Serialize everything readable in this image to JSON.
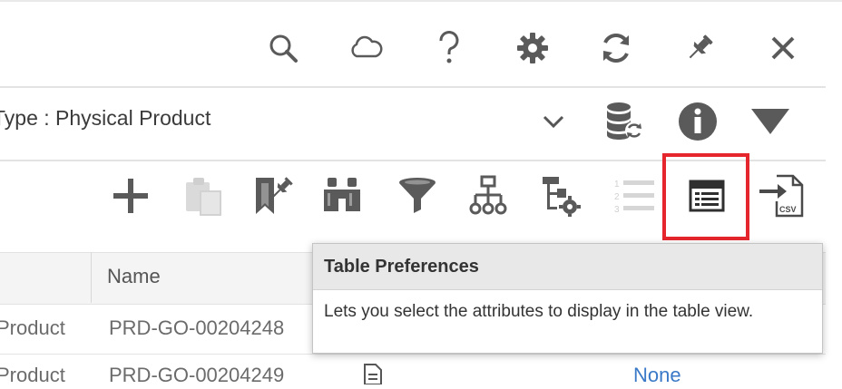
{
  "header": {
    "icons": [
      "search-icon",
      "cloud-icon",
      "help-icon",
      "settings-gear-icon",
      "refresh-icon",
      "pin-icon",
      "close-icon"
    ]
  },
  "type_bar": {
    "label": "Type : Physical Product",
    "icons": [
      "chevron-down-icon",
      "database-sync-icon",
      "info-icon",
      "filter-triangle-icon"
    ]
  },
  "toolbar": {
    "icons": [
      "add-icon",
      "paste-icon",
      "bookmark-pin-icon",
      "binoculars-icon",
      "filter-funnel-icon",
      "hierarchy-icon",
      "tree-settings-icon",
      "numbered-list-icon",
      "table-preferences-icon",
      "export-csv-icon"
    ],
    "csv_badge": "CSV"
  },
  "table": {
    "headers": [
      "Name"
    ],
    "rows": [
      {
        "type": "Product",
        "name": "PRD-GO-00204248"
      },
      {
        "type": "Product",
        "name": "PRD-GO-00204249",
        "extra": "None"
      }
    ]
  },
  "tooltip": {
    "title": "Table Preferences",
    "body": "Lets you select the attributes to display in the table view."
  },
  "colors": {
    "icon_gray": "#5a5a5a",
    "highlight_red": "#e5262c",
    "link_blue": "#3a79c7"
  }
}
